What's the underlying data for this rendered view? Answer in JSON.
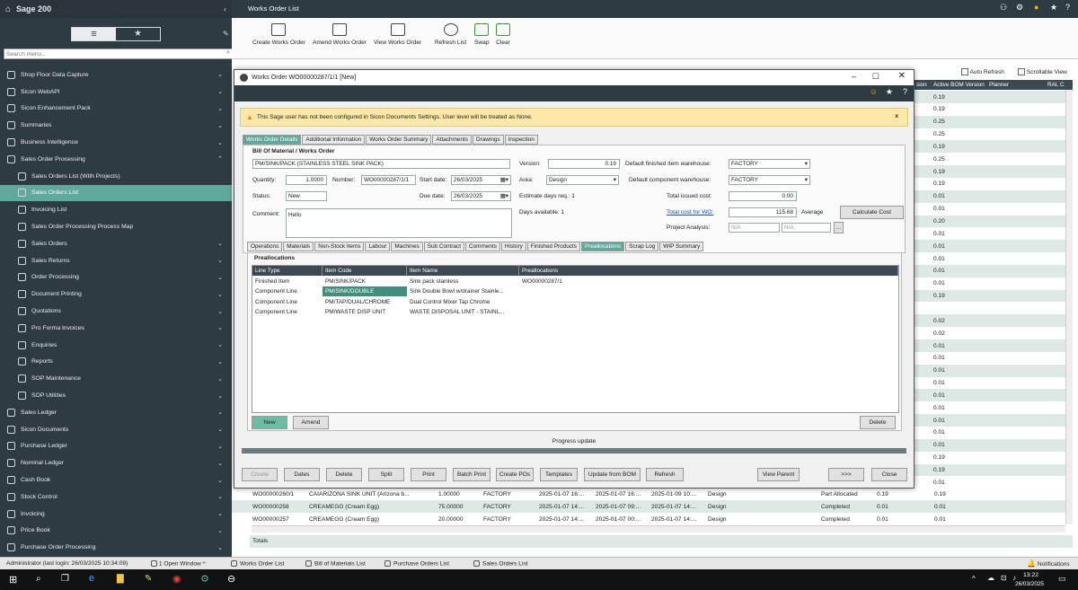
{
  "sidebar": {
    "app_title": "Sage 200",
    "search_placeholder": "Search menu...",
    "items": [
      {
        "label": "Shop Floor Data Capture",
        "level": 0,
        "expanded": false
      },
      {
        "label": "Sicon WebAPI",
        "level": 0,
        "expanded": false
      },
      {
        "label": "Sicon Enhancement Pack",
        "level": 0,
        "expanded": false
      },
      {
        "label": "Summaries",
        "level": 0,
        "expanded": false
      },
      {
        "label": "Business Intelligence",
        "level": 0,
        "expanded": false
      },
      {
        "label": "Sales Order Processing",
        "level": 0,
        "expanded": true
      },
      {
        "label": "Sales Orders List (With Projects)",
        "level": 1
      },
      {
        "label": "Sales Orders List",
        "level": 1,
        "selected": true
      },
      {
        "label": "Invoicing List",
        "level": 1
      },
      {
        "label": "Sales Order Processing Process Map",
        "level": 1
      },
      {
        "label": "Sales Orders",
        "level": 1,
        "expanded": false
      },
      {
        "label": "Sales Returns",
        "level": 1,
        "expanded": false
      },
      {
        "label": "Order Processing",
        "level": 1,
        "expanded": false
      },
      {
        "label": "Document Printing",
        "level": 1,
        "expanded": false
      },
      {
        "label": "Quotations",
        "level": 1,
        "expanded": false
      },
      {
        "label": "Pro Forma Invoices",
        "level": 1,
        "expanded": false
      },
      {
        "label": "Enquiries",
        "level": 1,
        "expanded": false
      },
      {
        "label": "Reports",
        "level": 1,
        "expanded": false
      },
      {
        "label": "SOP Maintenance",
        "level": 1,
        "expanded": false
      },
      {
        "label": "SOP Utilities",
        "level": 1,
        "expanded": false
      },
      {
        "label": "Sales Ledger",
        "level": 0,
        "expanded": false
      },
      {
        "label": "Sicon Documents",
        "level": 0,
        "expanded": false
      },
      {
        "label": "Purchase Ledger",
        "level": 0,
        "expanded": false
      },
      {
        "label": "Nominal Ledger",
        "level": 0,
        "expanded": false
      },
      {
        "label": "Cash Book",
        "level": 0,
        "expanded": false
      },
      {
        "label": "Stock Control",
        "level": 0,
        "expanded": false
      },
      {
        "label": "Invoicing",
        "level": 0,
        "expanded": false
      },
      {
        "label": "Price Book",
        "level": 0,
        "expanded": false
      },
      {
        "label": "Purchase Order Processing",
        "level": 0,
        "expanded": false
      }
    ]
  },
  "topbar": {
    "title": "Works Order List"
  },
  "toolbar": {
    "create": "Create Works Order",
    "amend": "Amend Works Order",
    "view": "View Works Order",
    "refresh": "Refresh List",
    "swap": "Swap",
    "clear": "Clear"
  },
  "list": {
    "auto_refresh": "Auto Refresh",
    "scrollable_view": "Scrollable View",
    "headers": {
      "c1": "sion",
      "c2": "Active BOM Version",
      "c3": "Planner",
      "c4": "RAL C"
    },
    "right_values": [
      "0.19",
      "0.19",
      "0.25",
      "0.25",
      "0.19",
      "0.25",
      "0.19",
      "0.19",
      "0.01",
      "0.01",
      "0.20",
      "0.01",
      "0.01",
      "0.01",
      "0.01",
      "0.01",
      "0.19",
      "",
      "0.02",
      "0.02",
      "0.01",
      "0.01",
      "0.01",
      "0.01",
      "0.01",
      "0.01",
      "0.01",
      "0.01",
      "0.01",
      "0.19",
      "0.19",
      "0.01",
      "0.01"
    ],
    "bottom_rows": [
      {
        "wo": "WO00000260/1",
        "item": "CAIARIZONA SINK UNIT  (Arizona b...",
        "qty": "1.00000",
        "wh": "FACTORY",
        "d1": "2025-01-07  16:...",
        "d2": "2025-01-07  16:...",
        "d3": "2025-01-09  10:...",
        "area": "Design",
        "status": "Part Allocated",
        "ver": "0.19",
        "bom": "0.19"
      },
      {
        "wo": "WO00000258",
        "item": "CREAMEGG  (Cream Egg)",
        "qty": "75.00000",
        "wh": "FACTORY",
        "d1": "2025-01-07  14:...",
        "d2": "2025-01-07  09:...",
        "d3": "2025-01-07  14:...",
        "area": "Design",
        "status": "Completed",
        "ver": "0.01",
        "bom": "0.01"
      },
      {
        "wo": "WO00000257",
        "item": "CREAMEGG  (Cream Egg)",
        "qty": "20.00000",
        "wh": "FACTORY",
        "d1": "2025-01-07  14:...",
        "d2": "2025-01-07  00:...",
        "d3": "2025-01-07  14:...",
        "area": "Design",
        "status": "Completed",
        "ver": "0.01",
        "bom": "0.01"
      }
    ],
    "totals": "Totals"
  },
  "window": {
    "title": "Works Order WO00000287/1/1 [New]",
    "warning": "This Sage user has not been configured in Sicon Documents Settings. User level will be treated as None.",
    "warning_close": "x",
    "tabs": [
      "Works Order Details",
      "Additional Information",
      "Works Order Summary",
      "Attachments",
      "Drawings",
      "Inspection"
    ],
    "section": "Bill Of Material / Works Order",
    "bom": "PM/SINK/PACK  (STAINLESS STEEL SINK PACK)",
    "version_label": "Version:",
    "version": "0.19",
    "quantity_label": "Quantity:",
    "quantity": "1.0000",
    "number_label": "Number:",
    "number": "WO00000287/1/1",
    "start_label": "Start date:",
    "start": "26/03/2025",
    "area_label": "Area:",
    "area": "Design",
    "status_label": "Status:",
    "status": "New",
    "due_label": "Due date:",
    "due": "26/03/2025",
    "comment_label": "Comment:",
    "comment": "Hello",
    "est_days": "Estimate days req.: 1",
    "days_avail": "Days available: 1",
    "def_fin_label": "Default finished item warehouse:",
    "def_fin": "FACTORY",
    "def_comp_label": "Default component warehouse:",
    "def_comp": "FACTORY",
    "issued_label": "Total issued cost:",
    "issued": "0.00",
    "total_label": "Total cost for WO:",
    "total": "115.68",
    "total_method": "Average",
    "calc": "Calculate Cost",
    "proj_label": "Project Analysis:",
    "proj1": "N/A",
    "proj2": "N/A",
    "proj_btn": "...",
    "subtabs": [
      "Operations",
      "Materials",
      "Non-Stock Items",
      "Labour",
      "Machines",
      "Sub Contract",
      "Comments",
      "History",
      "Finished Products",
      "Preallocations",
      "Scrap Log",
      "WIP Summary"
    ],
    "grid_title": "Preallocations",
    "grid_headers": [
      "Line Type",
      "Item Code",
      "Item Name",
      "Preallocations"
    ],
    "grid_rows": [
      [
        "Finished Item",
        "PM/SINK/PACK",
        "Sink pack stainless",
        "WO00000287/1"
      ],
      [
        "Component Line",
        "PM/SINK/DOUBLE",
        "Sink Double Bowl w/drainer Stainle...",
        ""
      ],
      [
        "Component Line",
        "PM/TAP/DUAL/CHROME",
        "Dual Control Mixer Tap Chrome",
        ""
      ],
      [
        "Component Line",
        "PM/WASTE DISP UNIT",
        "WASTE DISPOSAL UNIT - STAINL...",
        ""
      ]
    ],
    "new": "New",
    "amend": "Amend",
    "delete": "Delete",
    "progress": "Progress update",
    "buttons": {
      "create": "Create",
      "dates": "Dates",
      "delete": "Delete",
      "split": "Split",
      "print": "Print",
      "batch": "Batch Print",
      "pos": "Create POs",
      "templates": "Templates",
      "update": "Update from BOM",
      "refresh": "Refresh",
      "parent": "View Parent",
      "more": ">>>",
      "close": "Close"
    }
  },
  "status": {
    "user": "Administrator (last login: 26/03/2025 10:34:09)",
    "windows": "1 Open Window ^",
    "tabs": [
      "Works Order List",
      "Bill of Materials List",
      "Purchase Orders List",
      "Sales Orders List"
    ],
    "notifications": "Notifications"
  },
  "taskbar": {
    "time": "13:22",
    "date": "26/03/2025"
  },
  "colors": {
    "sidebar": "#2f3b42",
    "accent": "#5fa99a",
    "warning": "#fce7a8"
  }
}
